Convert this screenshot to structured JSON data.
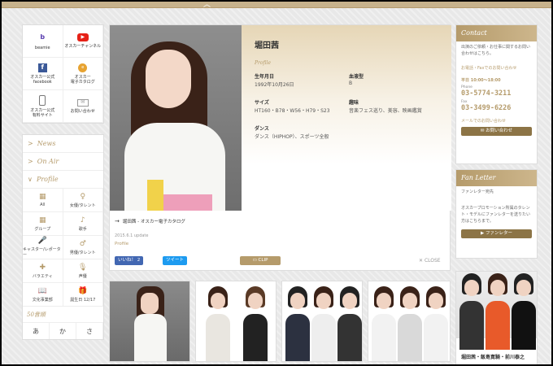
{
  "leftIcons": [
    {
      "label": "beamie",
      "icon": "beamie-logo-icon",
      "color": "#5b3fb0"
    },
    {
      "label": "オスカーチャンネル",
      "icon": "youtube-icon",
      "color": "#e62117"
    },
    {
      "label": "オスカー公式\nfacebook",
      "icon": "facebook-icon",
      "color": "#3b5998"
    },
    {
      "label": "オスカー\n電子カタログ",
      "icon": "catalog-icon",
      "color": "#e7a331"
    },
    {
      "label": "オスカー公式\n有料サイト",
      "icon": "smartphone-icon",
      "color": "#666666"
    },
    {
      "label": "お問い合わせ",
      "icon": "mail-icon",
      "color": "#999999"
    }
  ],
  "nav": [
    "News",
    "On Air",
    "Profile"
  ],
  "categories": [
    {
      "label": "All",
      "glyph": "▦"
    },
    {
      "label": "女優/タレント",
      "glyph": "♀"
    },
    {
      "label": "グループ",
      "glyph": "▦"
    },
    {
      "label": "歌手",
      "glyph": "♪"
    },
    {
      "label": "キャスター/レポーター",
      "glyph": "🎤"
    },
    {
      "label": "男優/タレント",
      "glyph": "♂"
    },
    {
      "label": "バラエティ",
      "glyph": "✚"
    },
    {
      "label": "声優",
      "glyph": "🎙"
    },
    {
      "label": "文化事業部",
      "glyph": "📖"
    },
    {
      "label": "誕生日 12/17",
      "glyph": "🎁"
    }
  ],
  "gojuon_title": "50音順",
  "kana": [
    "あ",
    "か",
    "さ"
  ],
  "profile": {
    "name": "堀田茜",
    "section": "Profile",
    "birthday_label": "生年月日",
    "birthday": "1992年10月26日",
    "blood_label": "血液型",
    "blood": "B",
    "size_label": "サイズ",
    "size": "HT160・B78・W56・H79・S23",
    "hobby_label": "趣味",
    "hobby": "音楽フェス巡り、美容、映画鑑賞",
    "dance_label": "ダンス",
    "dance": "ダンス（HIPHOP）、スポーツ全般"
  },
  "catalog_link": "堀田茜 - オスカー電子カタログ",
  "update": "2015.6.1 update",
  "profile_link": "Profile",
  "fb_like": "いいね！ 2",
  "tweet": "ツイート",
  "clip": "CLIP",
  "close": "CLOSE",
  "contact": {
    "title": "Contact",
    "desc": "出演のご依頼・お仕事に関するお問い合わせはこちら。",
    "phone_fax_label": "お電話・Faxでのお問い合わせ",
    "hours": "平日 10:00〜18:00",
    "phone_label": "Phone",
    "phone": "03-5774-3211",
    "fax_label": "Fax",
    "fax": "03-3499-6226",
    "mail_label": "メールでのお問い合わせ",
    "mail_btn": "お問い合わせ"
  },
  "fanletter": {
    "title": "Fan Letter",
    "sub": "ファンレター宛先",
    "desc": "オスカープロモーション所属のタレント・モデルにファンレターを送りたい方はこちらまで。",
    "btn": "ファンレター"
  },
  "bottom_caption": "堀田茜・飯島寛騎・前川泰之",
  "colors": {
    "gold": "#b59b6b",
    "accent": "#8c7446"
  }
}
